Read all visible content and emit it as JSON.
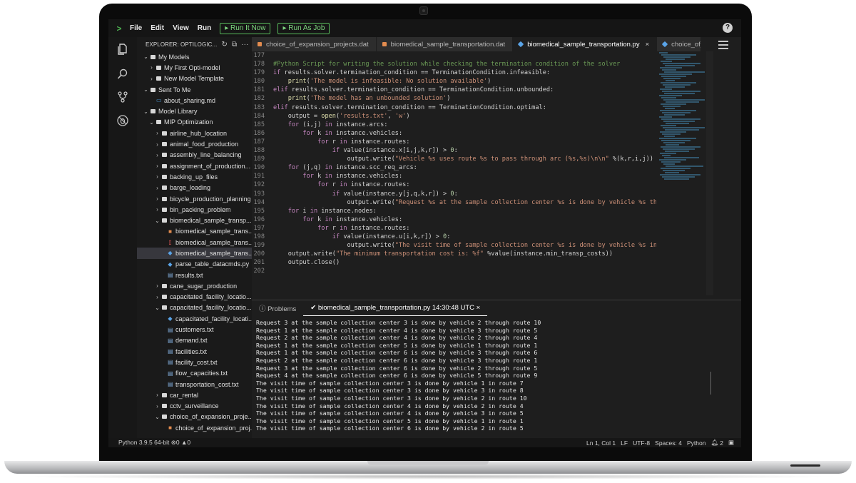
{
  "menubar": {
    "logo": ">",
    "items": [
      "File",
      "Edit",
      "View",
      "Run"
    ],
    "run_now": "Run It Now",
    "run_job": "Run As Job",
    "help": "?"
  },
  "explorer": {
    "title": "EXPLORER: OPTILOGIC...",
    "items": [
      {
        "label": "My Models",
        "depth": 0,
        "kind": "folder",
        "open": true
      },
      {
        "label": "My First Opti-model",
        "depth": 1,
        "kind": "folder",
        "open": false
      },
      {
        "label": "New Model Template",
        "depth": 1,
        "kind": "folder",
        "open": false
      },
      {
        "label": "Sent To Me",
        "depth": 0,
        "kind": "folder",
        "open": true
      },
      {
        "label": "about_sharing.md",
        "depth": 1,
        "kind": "md"
      },
      {
        "label": "Model Library",
        "depth": 0,
        "kind": "folder",
        "open": true
      },
      {
        "label": "MIP Optimization",
        "depth": 1,
        "kind": "folder",
        "open": true
      },
      {
        "label": "airline_hub_location",
        "depth": 2,
        "kind": "folder",
        "open": false
      },
      {
        "label": "animal_food_production",
        "depth": 2,
        "kind": "folder",
        "open": false
      },
      {
        "label": "assembly_line_balancing",
        "depth": 2,
        "kind": "folder",
        "open": false
      },
      {
        "label": "assignment_of_production...",
        "depth": 2,
        "kind": "folder",
        "open": false
      },
      {
        "label": "backing_up_files",
        "depth": 2,
        "kind": "folder",
        "open": false
      },
      {
        "label": "barge_loading",
        "depth": 2,
        "kind": "folder",
        "open": false
      },
      {
        "label": "bicycle_production_planning",
        "depth": 2,
        "kind": "folder",
        "open": false
      },
      {
        "label": "bin_packing_problem",
        "depth": 2,
        "kind": "folder",
        "open": false
      },
      {
        "label": "biomedical_sample_transp...",
        "depth": 2,
        "kind": "folder",
        "open": true
      },
      {
        "label": "biomedical_sample_trans...",
        "depth": 3,
        "kind": "dat"
      },
      {
        "label": "biomedical_sample_trans...",
        "depth": 3,
        "kind": "pdf"
      },
      {
        "label": "biomedical_sample_trans...",
        "depth": 3,
        "kind": "py",
        "selected": true
      },
      {
        "label": "parse_table_datacmds.py",
        "depth": 3,
        "kind": "py"
      },
      {
        "label": "results.txt",
        "depth": 3,
        "kind": "txt"
      },
      {
        "label": "cane_sugar_production",
        "depth": 2,
        "kind": "folder",
        "open": false
      },
      {
        "label": "capacitated_facility_locatio...",
        "depth": 2,
        "kind": "folder",
        "open": false
      },
      {
        "label": "capacitated_facility_locatio...",
        "depth": 2,
        "kind": "folder",
        "open": true
      },
      {
        "label": "capacitated_facility_locati...",
        "depth": 3,
        "kind": "py"
      },
      {
        "label": "customers.txt",
        "depth": 3,
        "kind": "txt"
      },
      {
        "label": "demand.txt",
        "depth": 3,
        "kind": "txt"
      },
      {
        "label": "facilities.txt",
        "depth": 3,
        "kind": "txt"
      },
      {
        "label": "facility_cost.txt",
        "depth": 3,
        "kind": "txt"
      },
      {
        "label": "flow_capacities.txt",
        "depth": 3,
        "kind": "txt"
      },
      {
        "label": "transportation_cost.txt",
        "depth": 3,
        "kind": "txt"
      },
      {
        "label": "car_rental",
        "depth": 2,
        "kind": "folder",
        "open": false
      },
      {
        "label": "cctv_surveillance",
        "depth": 2,
        "kind": "folder",
        "open": false
      },
      {
        "label": "choice_of_expansion_proje...",
        "depth": 2,
        "kind": "folder",
        "open": true
      },
      {
        "label": "choice_of_expansion_proj...",
        "depth": 3,
        "kind": "dat"
      }
    ]
  },
  "tabs": [
    {
      "label": "choice_of_expansion_projects.dat",
      "kind": "dat",
      "active": false
    },
    {
      "label": "biomedical_sample_transportation.dat",
      "kind": "dat",
      "active": false
    },
    {
      "label": "biomedical_sample_transportation.py",
      "kind": "py",
      "active": true,
      "close": "×"
    },
    {
      "label": "choice_of_exp",
      "kind": "py",
      "active": false
    }
  ],
  "editor": {
    "lines": [
      {
        "n": "177",
        "html": ""
      },
      {
        "n": "178",
        "html": "<span style=\"color:#6a9955\">#Python Script for writing the solution while checking the termination condition of the solver</span>"
      },
      {
        "n": "179",
        "html": "<span style=\"color:#c586c0\">if</span> results.solver.termination_condition == TerminationCondition.infeasible:"
      },
      {
        "n": "180",
        "html": "    <span style=\"color:#dcdcaa\">print</span>(<span style=\"color:#ce9178\">'The model is infeasible: No solution available'</span>)"
      },
      {
        "n": "181",
        "html": "<span style=\"color:#c586c0\">elif</span> results.solver.termination_condition == TerminationCondition.unbounded:"
      },
      {
        "n": "182",
        "html": "    <span style=\"color:#dcdcaa\">print</span>(<span style=\"color:#ce9178\">'The model has an unbounded solution'</span>)"
      },
      {
        "n": "183",
        "html": "<span style=\"color:#c586c0\">elif</span> results.solver.termination_condition == TerminationCondition.optimal:"
      },
      {
        "n": "184",
        "html": "    output = <span style=\"color:#dcdcaa\">open</span>(<span style=\"color:#ce9178\">'results.txt'</span>, <span style=\"color:#ce9178\">'w'</span>)"
      },
      {
        "n": "185",
        "html": "    <span style=\"color:#c586c0\">for</span> (i,j) <span style=\"color:#c586c0\">in</span> instance.arcs:"
      },
      {
        "n": "186",
        "html": "        <span style=\"color:#c586c0\">for</span> k <span style=\"color:#c586c0\">in</span> instance.vehicles:"
      },
      {
        "n": "187",
        "html": "            <span style=\"color:#c586c0\">for</span> r <span style=\"color:#c586c0\">in</span> instance.routes:"
      },
      {
        "n": "188",
        "html": "                <span style=\"color:#c586c0\">if</span> value(instance.x[i,j,k,r]) > <span style=\"color:#b5cea8\">0</span>:"
      },
      {
        "n": "189",
        "html": "                    output.write(<span style=\"color:#ce9178\">\"Vehicle %s uses route %s to pass through arc (%s,%s)\\n\\n\"</span> %(k,r,i,j))"
      },
      {
        "n": "190",
        "html": "    <span style=\"color:#c586c0\">for</span> (j,q) <span style=\"color:#c586c0\">in</span> instance.scc_req_arcs:"
      },
      {
        "n": "191",
        "html": "        <span style=\"color:#c586c0\">for</span> k <span style=\"color:#c586c0\">in</span> instance.vehicles:"
      },
      {
        "n": "192",
        "html": "            <span style=\"color:#c586c0\">for</span> r <span style=\"color:#c586c0\">in</span> instance.routes:"
      },
      {
        "n": "193",
        "html": "                <span style=\"color:#c586c0\">if</span> value(instance.y[j,q,k,r]) > <span style=\"color:#b5cea8\">0</span>:"
      },
      {
        "n": "194",
        "html": "                    output.write(<span style=\"color:#ce9178\">\"Request %s at the sample collection center %s is done by vehicle %s th</span>"
      },
      {
        "n": "195",
        "html": "    <span style=\"color:#c586c0\">for</span> i <span style=\"color:#c586c0\">in</span> instance.nodes:"
      },
      {
        "n": "196",
        "html": "        <span style=\"color:#c586c0\">for</span> k <span style=\"color:#c586c0\">in</span> instance.vehicles:"
      },
      {
        "n": "197",
        "html": "            <span style=\"color:#c586c0\">for</span> r <span style=\"color:#c586c0\">in</span> instance.routes:"
      },
      {
        "n": "198",
        "html": "                <span style=\"color:#c586c0\">if</span> value(instance.u[i,k,r]) > <span style=\"color:#b5cea8\">0</span>:"
      },
      {
        "n": "199",
        "html": "                    output.write(<span style=\"color:#ce9178\">\"The visit time of sample collection center %s is done by vehicle %s in</span>"
      },
      {
        "n": "200",
        "html": "    output.write(<span style=\"color:#ce9178\">\"The minimum transportation cost is: %f\"</span> %value(instance.min_transp_costs))"
      },
      {
        "n": "201",
        "html": "    output.close()"
      },
      {
        "n": "202",
        "html": ""
      }
    ]
  },
  "panel": {
    "problems_tab": "Problems",
    "output_tab": "biomedical_sample_transportation.py 14:30:48 UTC",
    "close": "×",
    "output": [
      "Request 3 at the sample collection center 3 is done by vehicle 2 through route 10",
      "Request 1 at the sample collection center 4 is done by vehicle 3 through route 5",
      "Request 2 at the sample collection center 4 is done by vehicle 2 through route 4",
      "Request 1 at the sample collection center 5 is done by vehicle 1 through route 1",
      "Request 1 at the sample collection center 6 is done by vehicle 3 through route 6",
      "Request 2 at the sample collection center 6 is done by vehicle 3 through route 1",
      "Request 3 at the sample collection center 6 is done by vehicle 2 through route 5",
      "Request 4 at the sample collection center 6 is done by vehicle 5 through route 9",
      "The visit time of sample collection center 3 is done by vehicle 1 in route 7",
      "The visit time of sample collection center 3 is done by vehicle 3 in route 8",
      "The visit time of sample collection center 3 is done by vehicle 2 in route 10",
      "The visit time of sample collection center 4 is done by vehicle 2 in route 4",
      "The visit time of sample collection center 4 is done by vehicle 3 in route 5",
      "The visit time of sample collection center 5 is done by vehicle 1 in route 1",
      "The visit time of sample collection center 6 is done by vehicle 2 in route 5"
    ]
  },
  "statusbar": {
    "python": "Python 3.9.5 64-bit",
    "errors": "0",
    "warnings": "0",
    "position": "Ln 1, Col 1",
    "eol": "LF",
    "encoding": "UTF-8",
    "spaces": "Spaces: 4",
    "language": "Python",
    "notifications": "2"
  }
}
